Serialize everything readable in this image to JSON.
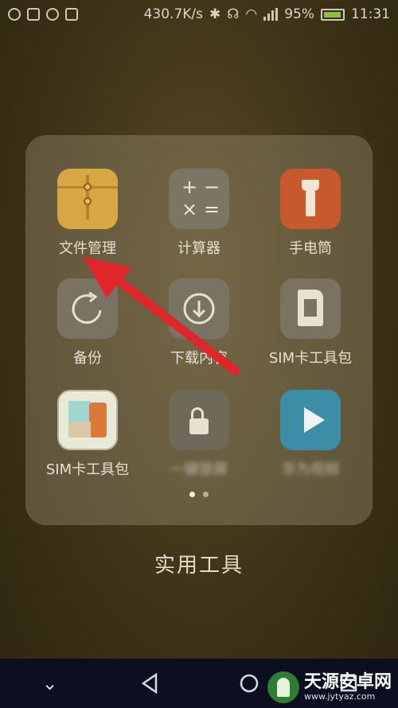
{
  "status_bar": {
    "speed": "430.7K/s",
    "battery": "95%",
    "time": "11:31"
  },
  "folder": {
    "title": "实用工具",
    "apps": [
      {
        "label": "文件管理",
        "icon": "file-manager-icon"
      },
      {
        "label": "计算器",
        "icon": "calculator-icon"
      },
      {
        "label": "手电筒",
        "icon": "flashlight-icon"
      },
      {
        "label": "备份",
        "icon": "backup-icon"
      },
      {
        "label": "下载内容",
        "icon": "download-icon"
      },
      {
        "label": "SIM卡工具包",
        "icon": "sim-toolkit-icon"
      },
      {
        "label": "SIM卡工具包",
        "icon": "sim-toolkit-icon-2"
      },
      {
        "label": "一键锁屏",
        "icon": "lock-icon"
      },
      {
        "label": "华为视频",
        "icon": "video-play-icon"
      }
    ],
    "page_count": 2,
    "current_page": 1
  },
  "calc_glyphs": [
    "+",
    "−",
    "×",
    "="
  ],
  "annotation": {
    "color": "#e0262b"
  },
  "nav_bar": {
    "buttons": [
      "down-chevron-icon",
      "back-icon",
      "home-icon",
      "recents-icon"
    ]
  },
  "watermark": {
    "main": "天源安卓网",
    "sub": "www.jytyaz.com"
  }
}
